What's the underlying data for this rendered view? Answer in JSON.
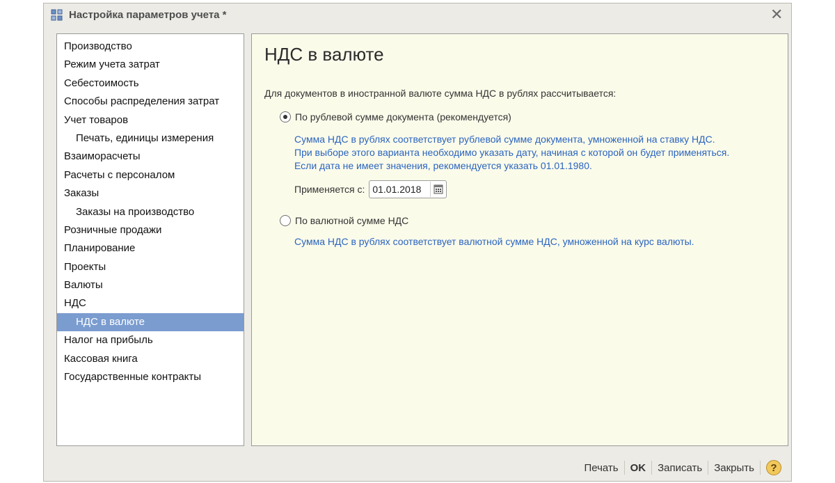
{
  "window": {
    "title": "Настройка параметров учета *",
    "icon": "settings-grid-icon",
    "close_glyph": "✕"
  },
  "nav": {
    "items": [
      {
        "label": "Производство",
        "level": 0
      },
      {
        "label": "Режим учета затрат",
        "level": 0
      },
      {
        "label": "Себестоимость",
        "level": 0
      },
      {
        "label": "Способы распределения затрат",
        "level": 0
      },
      {
        "label": "Учет товаров",
        "level": 0
      },
      {
        "label": "Печать, единицы измерения",
        "level": 1
      },
      {
        "label": "Взаиморасчеты",
        "level": 0
      },
      {
        "label": "Расчеты с персоналом",
        "level": 0
      },
      {
        "label": "Заказы",
        "level": 0
      },
      {
        "label": "Заказы на производство",
        "level": 1
      },
      {
        "label": "Розничные продажи",
        "level": 0
      },
      {
        "label": "Планирование",
        "level": 0
      },
      {
        "label": "Проекты",
        "level": 0
      },
      {
        "label": "Валюты",
        "level": 0
      },
      {
        "label": "НДС",
        "level": 0
      },
      {
        "label": "НДС в валюте",
        "level": 1,
        "selected": true
      },
      {
        "label": "Налог на прибыль",
        "level": 0
      },
      {
        "label": "Кассовая книга",
        "level": 0
      },
      {
        "label": "Государственные контракты",
        "level": 0
      }
    ],
    "selected_color": "#7a9ccf"
  },
  "content": {
    "title": "НДС в валюте",
    "intro": "Для документов в иностранной валюте сумма НДС в рублях рассчитывается:",
    "option1": {
      "label": "По рублевой сумме документа (рекомендуется)",
      "checked": true,
      "desc_lines": [
        "Сумма НДС в рублях соответствует рублевой сумме документа, умноженной на ставку НДС.",
        "При выборе этого варианта необходимо указать дату, начиная с которой он будет применяться.",
        "Если дата не имеет значения, рекомендуется указать 01.01.1980."
      ],
      "applies_label": "Применяется с:",
      "applies_value": "01.01.2018"
    },
    "option2": {
      "label": "По валютной сумме НДС",
      "checked": false,
      "desc": "Сумма НДС в рублях соответствует валютной сумме НДС, умноженной на курс валюты."
    },
    "desc_color": "#2a64bf"
  },
  "footer": {
    "print": "Печать",
    "ok": "OK",
    "save": "Записать",
    "close": "Закрыть",
    "help": "?"
  }
}
